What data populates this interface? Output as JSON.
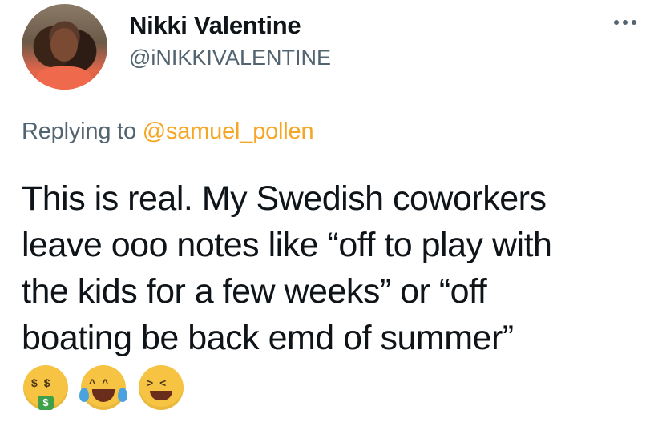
{
  "author": {
    "display_name": "Nikki Valentine",
    "handle": "@iNIKKIVALENTINE"
  },
  "reply": {
    "prefix": "Replying to",
    "mention": "@samuel_pollen"
  },
  "tweet": {
    "lines": [
      "This is real. My Swedish coworkers",
      "leave ooo notes like “off to play with",
      "the kids for a few weeks” or “off",
      "boating be back emd of summer”"
    ]
  },
  "emojis": [
    {
      "icon": "money-mouth-face-icon"
    },
    {
      "icon": "tears-of-joy-face-icon"
    },
    {
      "icon": "tired-face-icon"
    }
  ],
  "colors": {
    "mention": "#f5a623",
    "secondary_text": "#536471",
    "primary_text": "#0f1419"
  }
}
